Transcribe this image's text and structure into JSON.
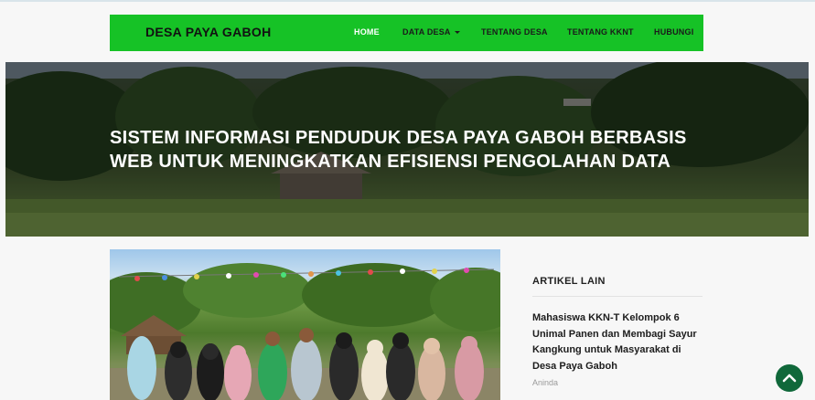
{
  "navbar": {
    "brand": "DESA PAYA GABOH",
    "items": [
      {
        "label": "HOME",
        "active": true
      },
      {
        "label": "DATA DESA",
        "dropdown": true
      },
      {
        "label": "TENTANG DESA"
      },
      {
        "label": "TENTANG KKNT"
      },
      {
        "label": "HUBUNGI"
      }
    ]
  },
  "hero": {
    "title_line1": "SISTEM INFORMASI PENDUDUK DESA PAYA GABOH BERBASIS",
    "title_line2": "WEB UNTUK MENINGKATKAN EFISIENSI PENGOLAHAN DATA"
  },
  "sidebar": {
    "heading": "ARTIKEL LAIN",
    "article": {
      "title": "Mahasiswa KKN-T Kelompok 6 Unimal Panen dan Membagi Sayur Kangkung untuk Masyarakat di Desa Paya Gaboh",
      "author": "Aninda"
    }
  },
  "colors": {
    "navbar": "#16c226",
    "scroll_top_button": "#10683a"
  },
  "icons": {
    "scroll_top": "chevron-up-icon"
  }
}
